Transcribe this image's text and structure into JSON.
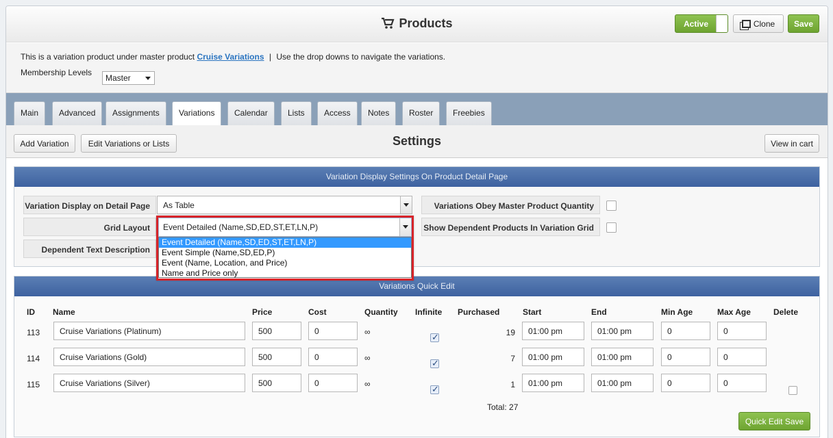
{
  "header": {
    "title": "Products",
    "active_label": "Active",
    "clone_label": "Clone",
    "save_label": "Save"
  },
  "info": {
    "prefix": "This is a variation product under master product",
    "master_link": "Cruise Variations",
    "separator": "|",
    "suffix": "Use the drop downs to navigate the variations.",
    "membership_label": "Membership Levels",
    "membership_value": "Master"
  },
  "tabs": [
    "Main",
    "Advanced",
    "Assignments",
    "Variations",
    "Calendar",
    "Lists",
    "Access",
    "Notes",
    "Roster",
    "Freebies"
  ],
  "active_tab": "Variations",
  "toolbar": {
    "add_variation": "Add Variation",
    "edit_variations": "Edit Variations or Lists",
    "title": "Settings",
    "view_in_cart": "View in cart"
  },
  "display_settings": {
    "heading": "Variation Display Settings On Product Detail Page",
    "display_label": "Variation Display on Detail Page",
    "display_value": "As Table",
    "grid_label": "Grid Layout",
    "grid_value": "Event Detailed (Name,SD,ED,ST,ET,LN,P)",
    "grid_options": [
      "Event Detailed (Name,SD,ED,ST,ET,LN,P)",
      "Event Simple (Name,SD,ED,P)",
      "Event (Name, Location, and Price)",
      "Name and Price only"
    ],
    "dependent_label": "Dependent Text Description",
    "obey_label": "Variations Obey Master Product Quantity",
    "show_dependent_label": "Show Dependent Products In Variation Grid"
  },
  "quick_edit": {
    "heading": "Variations Quick Edit",
    "columns": [
      "ID",
      "Name",
      "Price",
      "Cost",
      "Quantity",
      "Infinite",
      "Purchased",
      "Start",
      "End",
      "Min Age",
      "Max Age",
      "Delete"
    ],
    "rows": [
      {
        "id": "113",
        "name": "Cruise Variations (Platinum)",
        "price": "500",
        "cost": "0",
        "quantity": "∞",
        "purchased": "19",
        "start": "01:00 pm",
        "end": "01:00 pm",
        "min_age": "0",
        "max_age": "0"
      },
      {
        "id": "114",
        "name": "Cruise Variations (Gold)",
        "price": "500",
        "cost": "0",
        "quantity": "∞",
        "purchased": "7",
        "start": "01:00 pm",
        "end": "01:00 pm",
        "min_age": "0",
        "max_age": "0"
      },
      {
        "id": "115",
        "name": "Cruise Variations (Silver)",
        "price": "500",
        "cost": "0",
        "quantity": "∞",
        "purchased": "1",
        "start": "01:00 pm",
        "end": "01:00 pm",
        "min_age": "0",
        "max_age": "0"
      }
    ],
    "total_label": "Total: 27",
    "save_label": "Quick Edit Save"
  }
}
